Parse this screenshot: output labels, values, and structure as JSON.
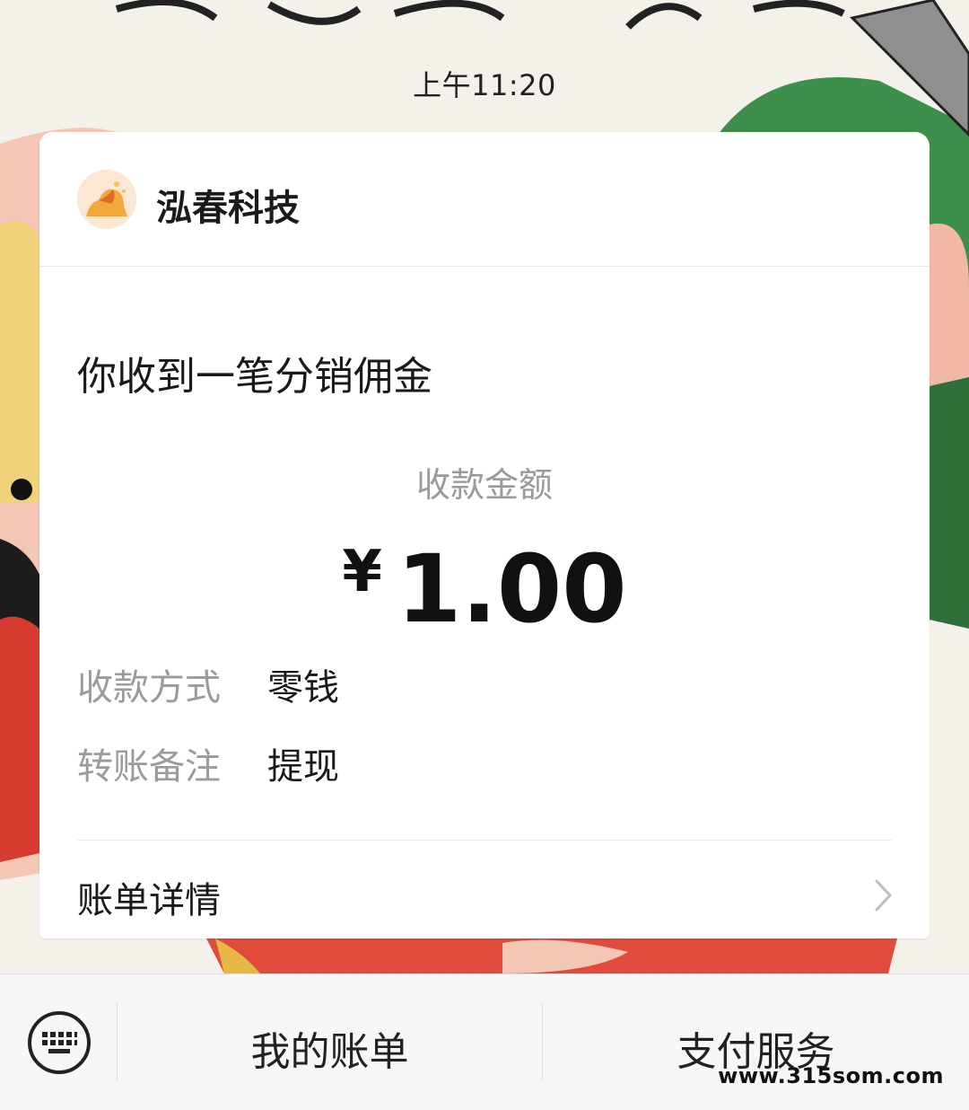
{
  "status_bar": {
    "time": "上午11:20"
  },
  "merchant": {
    "name": "泓春科技"
  },
  "message": {
    "title": "你收到一笔分销佣金"
  },
  "payment": {
    "amount_label": "收款金额",
    "currency_symbol": "¥",
    "amount": "1.00",
    "method_label": "收款方式",
    "method_value": "零钱",
    "note_label": "转账备注",
    "note_value": "提现"
  },
  "details_link": {
    "label": "账单详情",
    "icon": "chevron-right-icon"
  },
  "bottom_bar": {
    "keyboard_icon": "keyboard-icon",
    "tabs": [
      {
        "label": "我的账单"
      },
      {
        "label": "支付服务"
      }
    ]
  },
  "watermark": "www.315som.com"
}
